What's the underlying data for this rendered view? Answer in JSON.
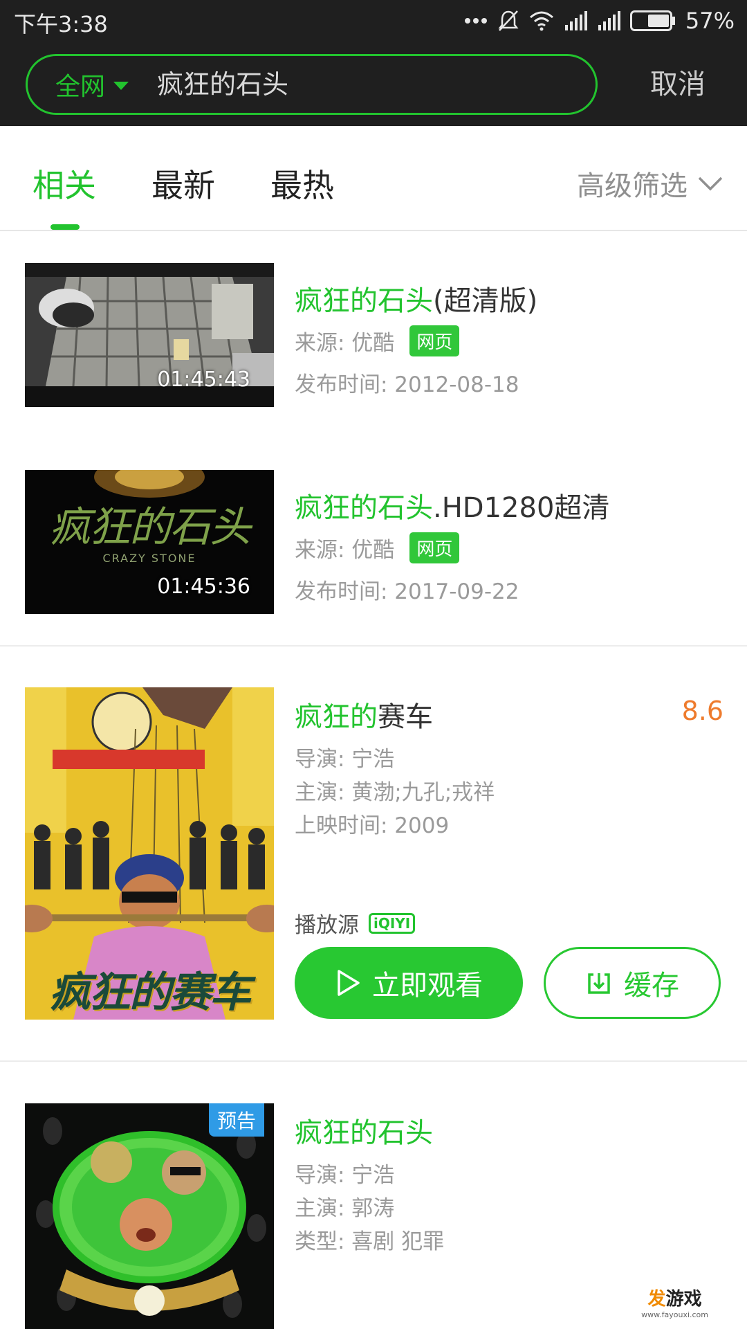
{
  "status_bar": {
    "time": "下午3:38",
    "battery": "57%"
  },
  "search": {
    "scope": "全网",
    "query": "疯狂的石头",
    "cancel": "取消"
  },
  "tabs": {
    "items": [
      "相关",
      "最新",
      "最热"
    ],
    "active_index": 0,
    "filter": "高级筛选"
  },
  "results": [
    {
      "title_highlight": "疯狂的石头",
      "title_rest": "(超清版)",
      "source": "来源: 优酷",
      "badge": "网页",
      "date": "发布时间: 2012-08-18",
      "duration": "01:45:43"
    },
    {
      "title_highlight": "疯狂的石头",
      "title_rest": ".HD1280超清",
      "source": "来源: 优酷",
      "badge": "网页",
      "date": "发布时间: 2017-09-22",
      "duration": "01:45:36",
      "thumb_text": "疯狂的石头",
      "thumb_sub": "CRAZY STONE"
    },
    {
      "title_highlight": "疯狂的",
      "title_rest": "赛车",
      "rating": "8.6",
      "director": "导演: 宁浩",
      "cast": "主演: 黄渤;九孔;戎祥",
      "release": "上映时间: 2009",
      "play_source": "播放源",
      "play_source_logo": "iQIYI",
      "watch_button": "立即观看",
      "cache_button": "缓存",
      "poster_text": "疯狂的赛车"
    },
    {
      "title_highlight": "疯狂的石头",
      "title_rest": "",
      "director": "导演: 宁浩",
      "cast": "主演: 郭涛",
      "genre": "类型: 喜剧 犯罪",
      "tag": "预告"
    }
  ],
  "watermark": {
    "main_a": "发",
    "main_b": "游戏",
    "sub": "www.fayouxi.com"
  },
  "colors": {
    "accent": "#22c32e",
    "rating": "#ee7b2d",
    "header_bg": "#1f1f1f",
    "trailer_tag": "#2f9be6"
  }
}
